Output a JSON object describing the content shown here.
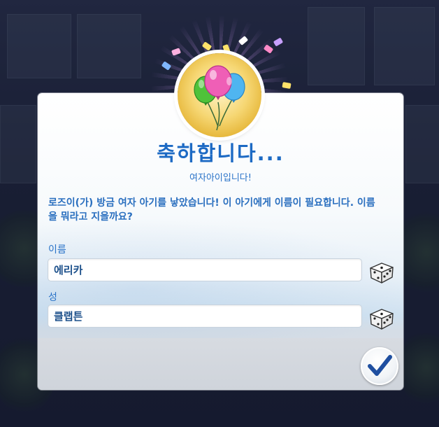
{
  "dialog": {
    "title": "축하합니다...",
    "subtitle": "여자아이입니다!",
    "message": "로즈이(가) 방금 여자 아기를 낳았습니다! 이 아기에게 이름이 필요합니다. 이름을 뭐라고 지을까요?",
    "first_name": {
      "label": "이름",
      "value": "에리카"
    },
    "last_name": {
      "label": "성",
      "value": "클랩튼"
    }
  },
  "icons": {
    "medal": "balloons-icon",
    "randomize": "dice-icon",
    "confirm": "checkmark-icon"
  },
  "colors": {
    "accent": "#1d6ac4",
    "confirm_check": "#1f4fa0",
    "medal_gold": "#e6b73a"
  }
}
